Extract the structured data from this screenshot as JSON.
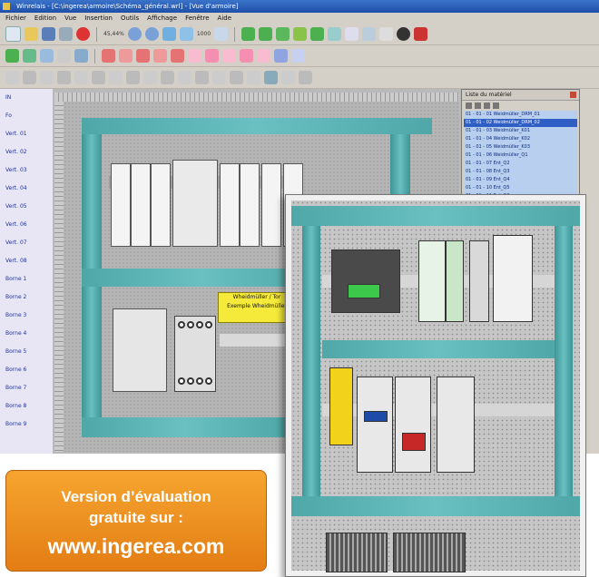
{
  "window": {
    "title": "Winrelais - [C:\\ingerea\\armoire\\Schéma_général.wrl] - [Vue d'armoire]",
    "menu": [
      "Fichier",
      "Edition",
      "Vue",
      "Insertion",
      "Outils",
      "Affichage",
      "Fenêtre",
      "Aide"
    ]
  },
  "toolbar": {
    "zoom_label": "45,44%",
    "scale_label": "1000"
  },
  "sidebar": {
    "items": [
      "IN",
      "Fo",
      "Vert. 01",
      "Vert. 02",
      "Vert. 03",
      "Vert. 04",
      "Vert. 05",
      "Vert. 06",
      "Vert. 07",
      "Vert. 08",
      "Borne 1",
      "Borne 2",
      "Borne 3",
      "Borne 4",
      "Borne 5",
      "Borne 6",
      "Borne 7",
      "Borne 8",
      "Borne 9"
    ]
  },
  "canvas": {
    "note_line1": "Wheidmüller / Tor",
    "note_line2": "Exemple Wheidmüller"
  },
  "panel": {
    "title": "Liste du matériel",
    "rows": [
      "01 - 01 - 01 Weidmüller_DRM_01",
      "01 - 01 - 02 Weidmüller_DRM_02",
      "01 - 01 - 03 Weidmüller_K01",
      "01 - 01 - 04 Weidmüller_K02",
      "01 - 01 - 05 Weidmüller_K03",
      "01 - 01 - 06 Weidmüller_Q1",
      "01 - 01 - 07 Ent_Q2",
      "01 - 01 - 08 Ent_Q3",
      "01 - 01 - 09 Ent_Q4",
      "01 - 01 - 10 Ent_Q5",
      "01 - 01 - 11 Ent_Q6"
    ]
  },
  "promo": {
    "line1": "Version d’évaluation",
    "line2": "gratuite sur :",
    "line3": "www.ingerea.com"
  },
  "colors": {
    "teal_rail": "#5fb3b3",
    "promo_orange": "#f29420",
    "selection_blue": "#2f5fc4",
    "note_yellow": "#f5ea3a"
  }
}
